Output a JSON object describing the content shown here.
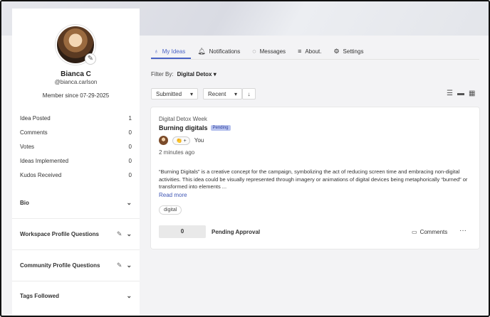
{
  "profile": {
    "name": "Bianca C",
    "handle": "@bianca.carlson",
    "member_since": "Member since 07-29-2025"
  },
  "stats": [
    {
      "label": "Idea Posted",
      "value": "1"
    },
    {
      "label": "Comments",
      "value": "0"
    },
    {
      "label": "Votes",
      "value": "0"
    },
    {
      "label": "Ideas Implemented",
      "value": "0"
    },
    {
      "label": "Kudos Received",
      "value": "0"
    }
  ],
  "sections": [
    {
      "label": "Bio"
    },
    {
      "label": "Workspace Profile Questions"
    },
    {
      "label": "Community Profile Questions"
    },
    {
      "label": "Tags Followed"
    }
  ],
  "tabs": [
    {
      "label": "My Ideas",
      "icon": "bulb-icon"
    },
    {
      "label": "Notifications",
      "icon": "bell-icon"
    },
    {
      "label": "Messages",
      "icon": "chat-icon"
    },
    {
      "label": "About.",
      "icon": "list-icon"
    },
    {
      "label": "Settings",
      "icon": "gear-icon"
    }
  ],
  "filter": {
    "label": "Filter By:",
    "value": "Digital Detox"
  },
  "sort": {
    "status": "Submitted",
    "order": "Recent"
  },
  "idea": {
    "category": "Digital Detox Week",
    "title": "Burning digitals",
    "badge": "Pending",
    "author": "You",
    "posted": "2 minutes ago",
    "description": "“Burning Digitals” is a creative concept for the campaign, symbolizing the act of reducing screen time and embracing non-digital activities. This idea could be visually represented through imagery or animations of digital devices being metaphorically “burned” or transformed into elements ...",
    "read_more": "Read more",
    "tag": "digital",
    "votes": "0",
    "status": "Pending Approval",
    "comments": "Comments"
  },
  "colors": {
    "accent": "#4a63c5",
    "badge_bg": "#b8c3ee"
  }
}
